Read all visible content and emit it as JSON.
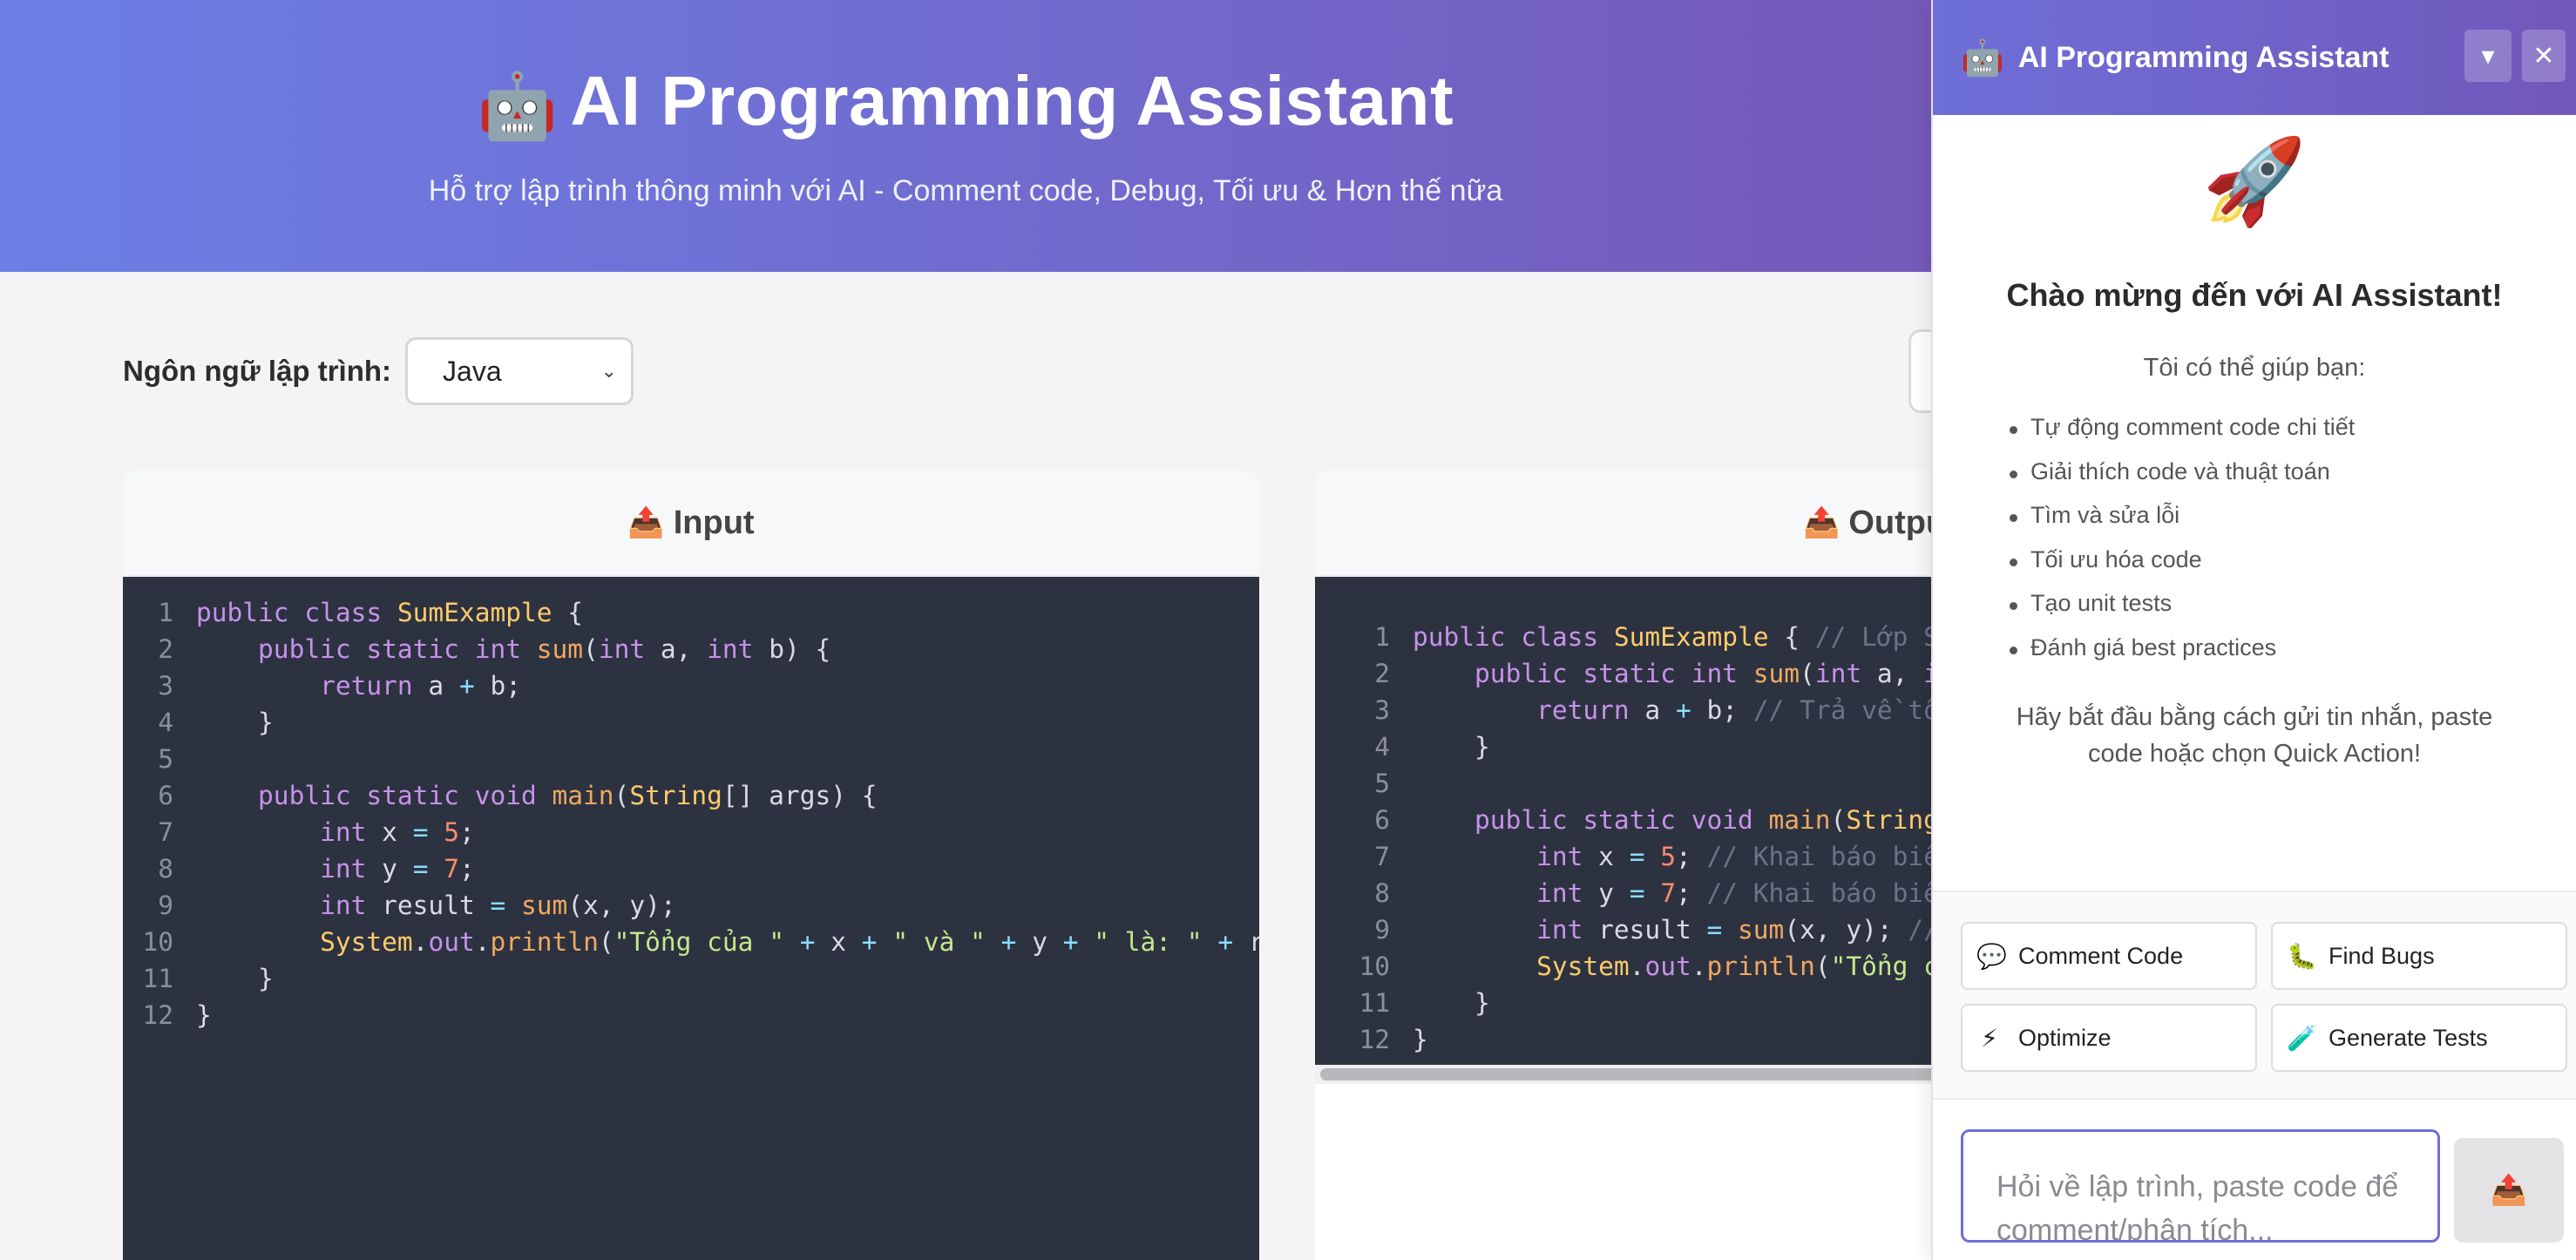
{
  "header": {
    "icon": "robot-icon",
    "emoji": "🤖",
    "title": "AI Programming Assistant",
    "subtitle": "Hỗ trợ lập trình thông minh với AI - Comment code, Debug, Tối ưu & Hơn thế nữa"
  },
  "controls": {
    "language_label": "Ngôn ngữ lập trình:",
    "language_value": "Java"
  },
  "input_panel": {
    "emoji": "📤",
    "title": "Input"
  },
  "output_panel": {
    "emoji": "📤",
    "title": "Outpu"
  },
  "input_code": [
    [
      {
        "t": "kw",
        "v": "public class "
      },
      {
        "t": "cls",
        "v": "SumExample"
      },
      {
        "t": "p",
        "v": " {"
      }
    ],
    [
      {
        "t": "p",
        "v": "    "
      },
      {
        "t": "kw",
        "v": "public static int "
      },
      {
        "t": "fn",
        "v": "sum"
      },
      {
        "t": "p",
        "v": "("
      },
      {
        "t": "kw",
        "v": "int"
      },
      {
        "t": "p",
        "v": " a, "
      },
      {
        "t": "kw",
        "v": "int"
      },
      {
        "t": "p",
        "v": " b) {"
      }
    ],
    [
      {
        "t": "p",
        "v": "        "
      },
      {
        "t": "kw",
        "v": "return"
      },
      {
        "t": "p",
        "v": " a "
      },
      {
        "t": "op",
        "v": "+"
      },
      {
        "t": "p",
        "v": " b;"
      }
    ],
    [
      {
        "t": "p",
        "v": "    }"
      }
    ],
    [
      {
        "t": "p",
        "v": ""
      }
    ],
    [
      {
        "t": "p",
        "v": "    "
      },
      {
        "t": "kw",
        "v": "public static void "
      },
      {
        "t": "fn",
        "v": "main"
      },
      {
        "t": "p",
        "v": "("
      },
      {
        "t": "cls",
        "v": "String"
      },
      {
        "t": "p",
        "v": "[] args) {"
      }
    ],
    [
      {
        "t": "p",
        "v": "        "
      },
      {
        "t": "kw",
        "v": "int"
      },
      {
        "t": "p",
        "v": " x "
      },
      {
        "t": "op",
        "v": "="
      },
      {
        "t": "p",
        "v": " "
      },
      {
        "t": "num",
        "v": "5"
      },
      {
        "t": "p",
        "v": ";"
      }
    ],
    [
      {
        "t": "p",
        "v": "        "
      },
      {
        "t": "kw",
        "v": "int"
      },
      {
        "t": "p",
        "v": " y "
      },
      {
        "t": "op",
        "v": "="
      },
      {
        "t": "p",
        "v": " "
      },
      {
        "t": "num",
        "v": "7"
      },
      {
        "t": "p",
        "v": ";"
      }
    ],
    [
      {
        "t": "p",
        "v": "        "
      },
      {
        "t": "kw",
        "v": "int"
      },
      {
        "t": "p",
        "v": " result "
      },
      {
        "t": "op",
        "v": "="
      },
      {
        "t": "p",
        "v": " "
      },
      {
        "t": "fn",
        "v": "sum"
      },
      {
        "t": "p",
        "v": "(x, y);"
      }
    ],
    [
      {
        "t": "p",
        "v": "        "
      },
      {
        "t": "cls",
        "v": "System"
      },
      {
        "t": "p",
        "v": "."
      },
      {
        "t": "kw",
        "v": "out"
      },
      {
        "t": "p",
        "v": "."
      },
      {
        "t": "fn",
        "v": "println"
      },
      {
        "t": "p",
        "v": "("
      },
      {
        "t": "str",
        "v": "\"Tổng của \""
      },
      {
        "t": "p",
        "v": " "
      },
      {
        "t": "op",
        "v": "+"
      },
      {
        "t": "p",
        "v": " x "
      },
      {
        "t": "op",
        "v": "+"
      },
      {
        "t": "p",
        "v": " "
      },
      {
        "t": "str",
        "v": "\" và \""
      },
      {
        "t": "p",
        "v": " "
      },
      {
        "t": "op",
        "v": "+"
      },
      {
        "t": "p",
        "v": " y "
      },
      {
        "t": "op",
        "v": "+"
      },
      {
        "t": "p",
        "v": " "
      },
      {
        "t": "str",
        "v": "\" là: \""
      },
      {
        "t": "p",
        "v": " "
      },
      {
        "t": "op",
        "v": "+"
      },
      {
        "t": "p",
        "v": " resul"
      }
    ],
    [
      {
        "t": "p",
        "v": "    }"
      }
    ],
    [
      {
        "t": "p",
        "v": "}"
      }
    ]
  ],
  "output_code": [
    [
      {
        "t": "kw",
        "v": "public class "
      },
      {
        "t": "cls",
        "v": "SumExample"
      },
      {
        "t": "p",
        "v": " { "
      },
      {
        "t": "cm",
        "v": "// Lớp Su"
      }
    ],
    [
      {
        "t": "p",
        "v": "    "
      },
      {
        "t": "kw",
        "v": "public static int "
      },
      {
        "t": "fn",
        "v": "sum"
      },
      {
        "t": "p",
        "v": "("
      },
      {
        "t": "kw",
        "v": "int"
      },
      {
        "t": "p",
        "v": " a, "
      },
      {
        "t": "kw",
        "v": "in"
      }
    ],
    [
      {
        "t": "p",
        "v": "        "
      },
      {
        "t": "kw",
        "v": "return"
      },
      {
        "t": "p",
        "v": " a "
      },
      {
        "t": "op",
        "v": "+"
      },
      {
        "t": "p",
        "v": " b; "
      },
      {
        "t": "cm",
        "v": "// Trả về tổn"
      }
    ],
    [
      {
        "t": "p",
        "v": "    }"
      }
    ],
    [
      {
        "t": "p",
        "v": ""
      }
    ],
    [
      {
        "t": "p",
        "v": "    "
      },
      {
        "t": "kw",
        "v": "public static void "
      },
      {
        "t": "fn",
        "v": "main"
      },
      {
        "t": "p",
        "v": "("
      },
      {
        "t": "cls",
        "v": "String"
      },
      {
        "t": "p",
        "v": "["
      }
    ],
    [
      {
        "t": "p",
        "v": "        "
      },
      {
        "t": "kw",
        "v": "int"
      },
      {
        "t": "p",
        "v": " x "
      },
      {
        "t": "op",
        "v": "="
      },
      {
        "t": "p",
        "v": " "
      },
      {
        "t": "num",
        "v": "5"
      },
      {
        "t": "p",
        "v": "; "
      },
      {
        "t": "cm",
        "v": "// Khai báo biến"
      }
    ],
    [
      {
        "t": "p",
        "v": "        "
      },
      {
        "t": "kw",
        "v": "int"
      },
      {
        "t": "p",
        "v": " y "
      },
      {
        "t": "op",
        "v": "="
      },
      {
        "t": "p",
        "v": " "
      },
      {
        "t": "num",
        "v": "7"
      },
      {
        "t": "p",
        "v": "; "
      },
      {
        "t": "cm",
        "v": "// Khai báo biến"
      }
    ],
    [
      {
        "t": "p",
        "v": "        "
      },
      {
        "t": "kw",
        "v": "int"
      },
      {
        "t": "p",
        "v": " result "
      },
      {
        "t": "op",
        "v": "="
      },
      {
        "t": "p",
        "v": " "
      },
      {
        "t": "fn",
        "v": "sum"
      },
      {
        "t": "p",
        "v": "(x, y); "
      },
      {
        "t": "cm",
        "v": "//"
      }
    ],
    [
      {
        "t": "p",
        "v": "        "
      },
      {
        "t": "cls",
        "v": "System"
      },
      {
        "t": "p",
        "v": "."
      },
      {
        "t": "kw",
        "v": "out"
      },
      {
        "t": "p",
        "v": "."
      },
      {
        "t": "fn",
        "v": "println"
      },
      {
        "t": "p",
        "v": "("
      },
      {
        "t": "str",
        "v": "\"Tổng củ"
      }
    ],
    [
      {
        "t": "p",
        "v": "    }"
      }
    ],
    [
      {
        "t": "p",
        "v": "}"
      }
    ]
  ],
  "assistant": {
    "emoji": "🤖",
    "title": "AI Programming Assistant",
    "minimize_label": "▾",
    "close_label": "✕",
    "rocket": "🚀",
    "welcome_title": "Chào mừng đến với AI Assistant!",
    "intro": "Tôi có thể giúp bạn:",
    "features": [
      "Tự động comment code chi tiết",
      "Giải thích code và thuật toán",
      "Tìm và sửa lỗi",
      "Tối ưu hóa code",
      "Tạo unit tests",
      "Đánh giá best practices"
    ],
    "cta": "Hãy bắt đầu bằng cách gửi tin nhắn, paste code hoặc chọn Quick Action!",
    "quick_actions": [
      {
        "emoji": "💬",
        "label": "Comment Code"
      },
      {
        "emoji": "🐛",
        "label": "Find Bugs"
      },
      {
        "emoji": "⚡",
        "label": "Optimize"
      },
      {
        "emoji": "🧪",
        "label": "Generate Tests"
      }
    ],
    "input_placeholder": "Hỏi về lập trình, paste code để comment/phân tích...",
    "send_emoji": "📤"
  },
  "colors": {
    "header_gradient_start": "#6c7fe6",
    "header_gradient_end": "#7559b9",
    "code_background": "#2d3240",
    "accent": "#6e6fd8"
  }
}
